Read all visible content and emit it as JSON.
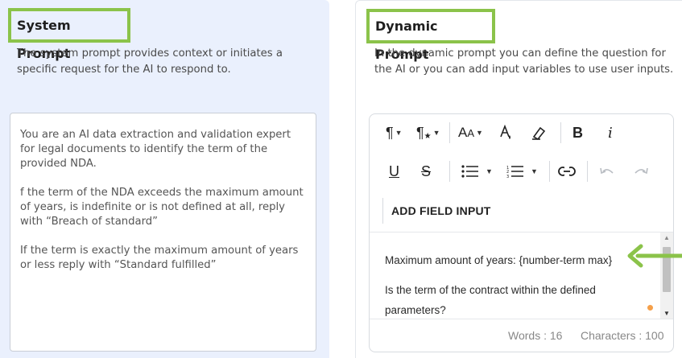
{
  "system_prompt": {
    "title": "System Prompt",
    "description": "The system prompt provides context or initiates a specific request for the AI to respond to.",
    "paragraphs": [
      "You are an AI data extraction and validation expert for legal documents to identify the term of the provided NDA.",
      "f the term of the NDA exceeds the maximum amount of years, is indefinite or is not defined at all, reply with “Breach of standard”",
      "If the term is exactly the maximum amount of years or less reply with “Standard fulfilled”"
    ]
  },
  "dynamic_prompt": {
    "title": "Dynamic Prompt",
    "description": "In the dynamic prompt you can define the question for the AI or you can add input variables to use user inputs.",
    "add_field_input": "ADD FIELD INPUT",
    "content_lines": [
      "Maximum amount of years: {number-term max}",
      "Is the term of the contract within the defined parameters?"
    ],
    "words_label": "Words : 16",
    "characters_label": "Characters : 100"
  },
  "toolbar_icons": [
    "paragraph-format-icon",
    "paragraph-style-icon",
    "font-size-icon",
    "text-color-icon",
    "clear-format-icon",
    "bold-icon",
    "italic-icon",
    "underline-icon",
    "strikethrough-icon",
    "bullet-list-icon",
    "numbered-list-icon",
    "link-icon",
    "undo-icon",
    "redo-icon"
  ],
  "colors": {
    "highlight": "#8bc34a",
    "left_panel_bg": "#eaf0fd",
    "indicator_dot": "#f5a04a"
  }
}
